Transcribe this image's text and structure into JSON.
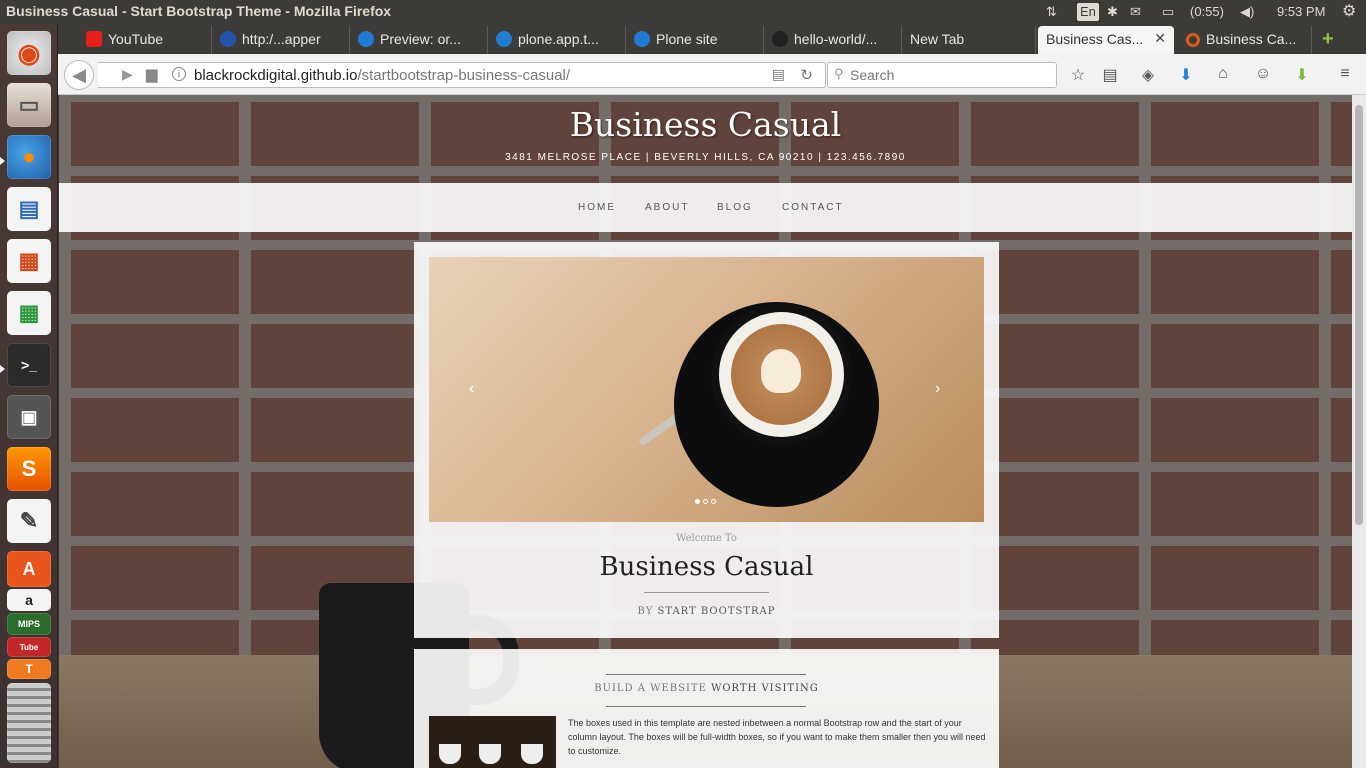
{
  "window": {
    "title": "Business Casual - Start Bootstrap Theme - Mozilla Firefox"
  },
  "indicators": {
    "keyboard": "En",
    "battery": "(0:55)",
    "clock": "9:53 PM"
  },
  "tabs": [
    {
      "label": "YouTube"
    },
    {
      "label": "http:/...apper"
    },
    {
      "label": "Preview: or..."
    },
    {
      "label": "plone.app.t..."
    },
    {
      "label": "Plone site"
    },
    {
      "label": "hello-world/..."
    },
    {
      "label": "New Tab"
    },
    {
      "label": "Business Cas..."
    },
    {
      "label": "Business Ca..."
    }
  ],
  "urlbar": {
    "domain": "blackrockdigital.github.io",
    "path": "/startbootstrap-business-casual/"
  },
  "search": {
    "placeholder": "Search"
  },
  "site": {
    "brand": "Business Casual",
    "address": "3481 MELROSE PLACE | BEVERLY HILLS, CA 90210 | 123.456.7890",
    "nav": [
      "HOME",
      "ABOUT",
      "BLOG",
      "CONTACT"
    ],
    "welcome": "Welcome To",
    "title": "Business Casual",
    "by_prefix": "BY",
    "by_name": "START BOOTSTRAP",
    "build_prefix": "BUILD A WEBSITE",
    "build_strong": "WORTH VISITING",
    "paragraph": "The boxes used in this template are nested inbetween a normal Bootstrap row and the start of your column layout. The boxes will be full-width boxes, so if you want to make them smaller then you will need to customize."
  },
  "colors": {
    "ubuntu_bar": "#3c3b37",
    "launcher": "#4a3a36",
    "active_tab": "#f5f5f5"
  }
}
